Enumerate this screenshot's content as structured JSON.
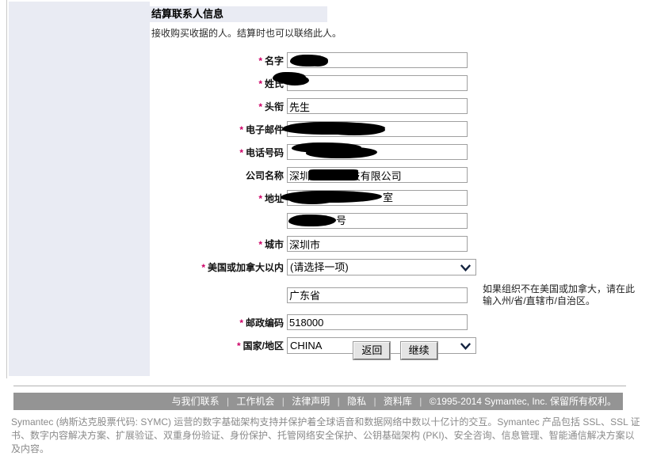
{
  "section": {
    "title": "结算联系人信息",
    "subtitle": "接收购买收据的人。结算时也可以联络此人。"
  },
  "form": {
    "rows": [
      {
        "label": "名字",
        "required": true,
        "type": "text",
        "value": "",
        "redacted": true
      },
      {
        "label": "姓氏",
        "required": true,
        "type": "text",
        "value": "",
        "redacted": true
      },
      {
        "label": "头衔",
        "required": true,
        "type": "text",
        "value": "先生",
        "redacted": false
      },
      {
        "label": "电子邮件",
        "required": true,
        "type": "text",
        "value": "",
        "redacted": true
      },
      {
        "label": "电话号码",
        "required": true,
        "type": "text",
        "value": "",
        "redacted": true
      },
      {
        "label": "公司名称",
        "required": false,
        "type": "text",
        "value": "深圳              技有限公司",
        "redacted": true
      },
      {
        "label": "地址",
        "required": true,
        "type": "text",
        "value": "",
        "redacted": true
      },
      {
        "label": "",
        "required": false,
        "type": "text",
        "value": "",
        "redacted": true
      },
      {
        "label": "城市",
        "required": true,
        "type": "text",
        "value": "深圳市",
        "redacted": false
      },
      {
        "label": "美国或加拿大以内",
        "required": true,
        "type": "select",
        "value": "(请选择一项)",
        "redacted": false
      },
      {
        "label": "",
        "required": false,
        "type": "text",
        "value": "广东省",
        "redacted": false
      },
      {
        "label": "邮政编码",
        "required": true,
        "type": "text",
        "value": "518000",
        "redacted": false
      },
      {
        "label": "国家/地区",
        "required": true,
        "type": "select",
        "value": "CHINA",
        "redacted": false
      }
    ],
    "address_line1_suffix": "室",
    "address_line2_suffix": "号",
    "state_note": "如果组织不在美国或加拿大，请在此输入州/省/直辖市/自治区。",
    "required_marker": "*"
  },
  "buttons": {
    "back": "返回",
    "continue": "继续"
  },
  "footer": {
    "links": [
      "与我们联系",
      "工作机会",
      "法律声明",
      "隐私",
      "资料库"
    ],
    "separator": "|",
    "copyright": "©1995-2014 Symantec, Inc. 保留所有权利。",
    "legal": "Symantec (纳斯达克股票代码: SYMC) 运营的数字基础架构支持并保护着全球语音和数据网络中数以十亿计的交互。Symantec 产品包括 SSL、SSL 证书、数字内容解决方案、扩展验证、双重身份验证、身份保护、托管网络安全保护、公钥基础架构 (PKI)、安全咨询、信息管理、智能通信解决方案以及内容。"
  },
  "colors": {
    "panel": "#e9ebf3",
    "footer_bar": "#949494",
    "required_star": "#cc0066",
    "legal_text": "#8a8a8a"
  }
}
